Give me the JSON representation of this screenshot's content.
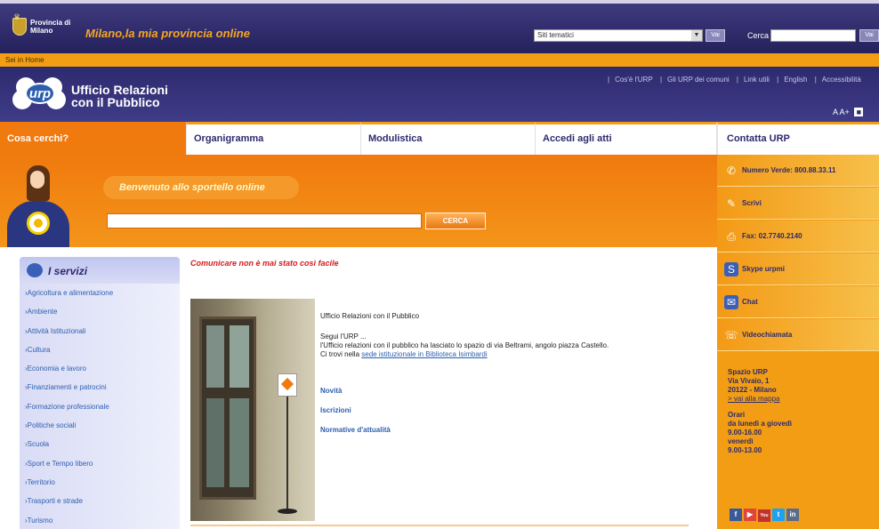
{
  "portal": {
    "logo_text": "Provincia di Milano",
    "tagline": "Milano,la mia provincia online",
    "topic_select": "Siti tematici",
    "topic_go": "Vai",
    "search_label": "Cerca",
    "search_go": "Vai"
  },
  "breadcrumb": "Sei in Home",
  "header": {
    "logo": "urp",
    "title_line1": "Ufficio Relazioni",
    "title_line2": "con il Pubblico",
    "links": [
      "Cos'è l'URP",
      "Gli URP dei comuni",
      "Link utili",
      "English",
      "Accessibilità"
    ],
    "font_small": "A",
    "font_large": "A+",
    "font_contrast": "■"
  },
  "nav": {
    "tabs": [
      "Cosa cerchi?",
      "Organigramma",
      "Modulistica",
      "Accedi agli atti"
    ],
    "contact_tab": "Contatta URP"
  },
  "hero": {
    "welcome": "Benvenuto allo sportello online",
    "search_button": "CERCA"
  },
  "contact": {
    "items": [
      "Numero Verde: 800.88.33.11",
      "Scrivi",
      "Fax: 02.7740.2140",
      "Skype urpmi",
      "Chat",
      "Videochiamata"
    ],
    "address": {
      "name": "Spazio URP",
      "street": "Via Vivaio, 1",
      "city": "20122 - Milano",
      "map_link": "> vai alla mappa",
      "hours_title": "Orari",
      "days": "da lunedì a giovedì",
      "hours1": "9.00-16.00",
      "friday": "venerdì",
      "hours2": "9.00-13.00"
    },
    "social": [
      "f",
      "▶",
      "You",
      "t",
      "in"
    ]
  },
  "services": {
    "title": "I servizi",
    "items": [
      "Agricoltura e alimentazione",
      "Ambiente",
      "Attività Istituzionali",
      "Cultura",
      "Economia e lavoro",
      "Finanziamenti e patrocini",
      "Formazione professionale",
      "Politiche sociali",
      "Scuola",
      "Sport e Tempo libero",
      "Territorio",
      "Trasporti e strade",
      "Turismo"
    ]
  },
  "main": {
    "title": "Comunicare non è mai stato così facile",
    "urp_name": "Ufficio Relazioni con il Pubblico",
    "intro1": "Segui l'URP ...",
    "intro2": "l'Ufficio relazioni con il pubblico ha lasciato lo spazio di via Beltrami, angolo piazza Castello.",
    "intro3_before": "Ci trovi nella",
    "intro3_link": "sede istituzionale in Biblioteca Isimbardi",
    "links": [
      "Novità",
      "Iscrizioni",
      "Normative d'attualità"
    ]
  }
}
